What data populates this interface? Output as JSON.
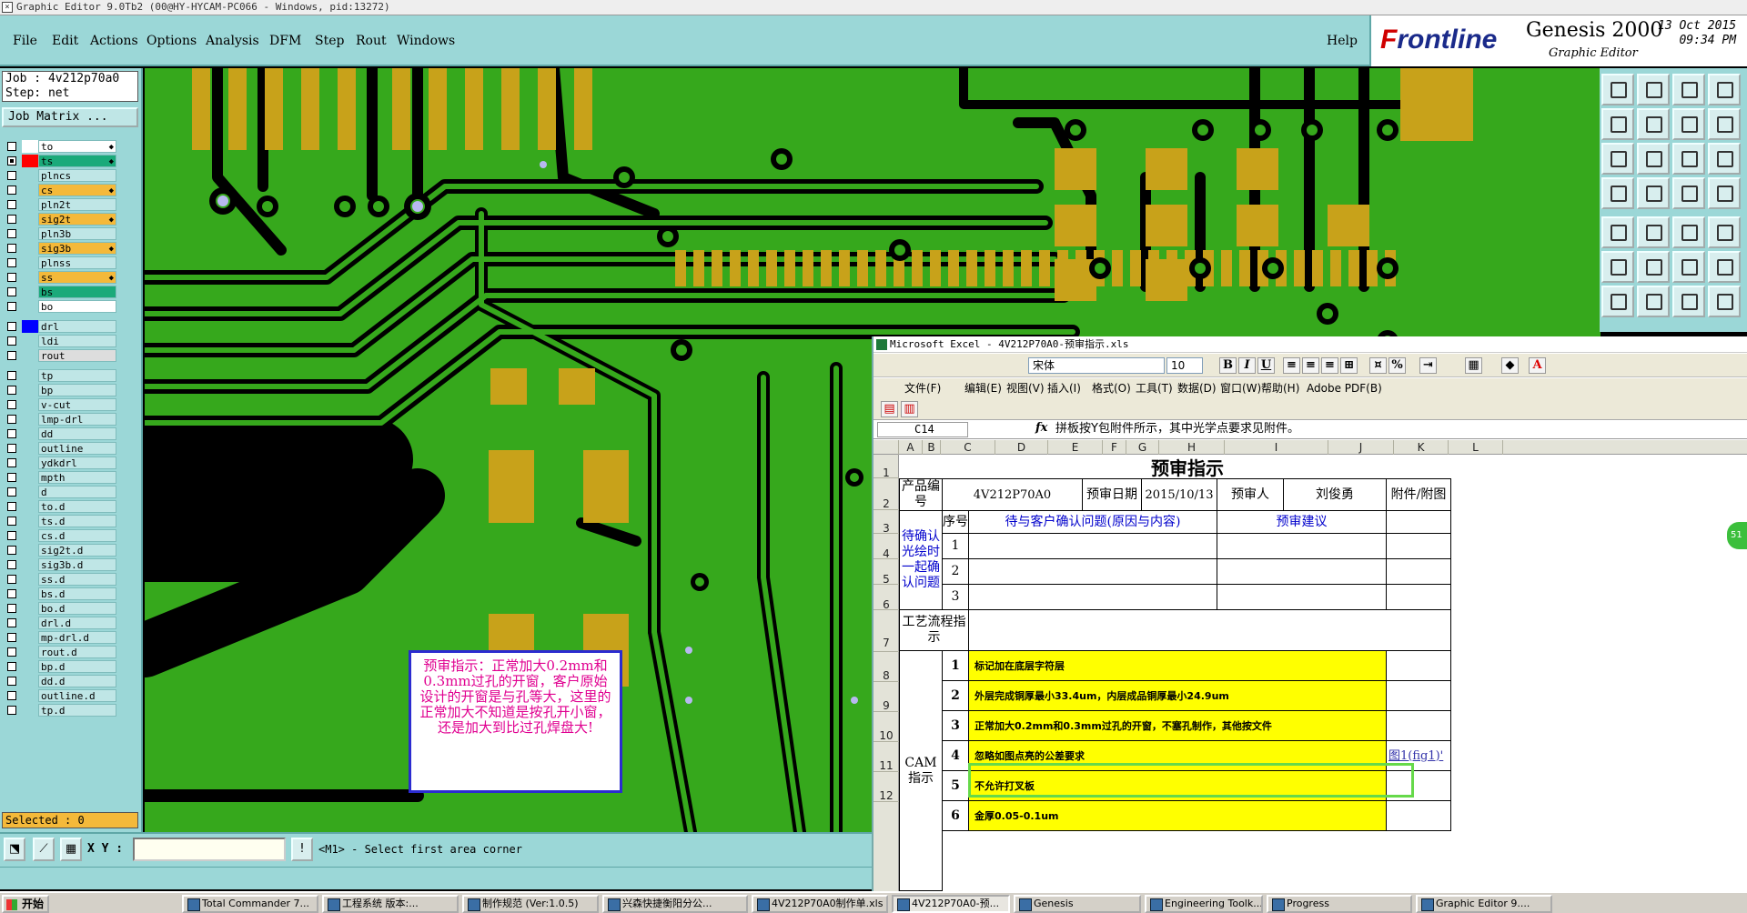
{
  "window": {
    "title": "Graphic Editor 9.0Tb2 (00@HY-HYCAM-PC066 - Windows, pid:13272)"
  },
  "menu": {
    "file": "File",
    "edit": "Edit",
    "actions": "Actions",
    "options": "Options",
    "analysis": "Analysis",
    "dfm": "DFM",
    "step": "Step",
    "rout": "Rout",
    "windows": "Windows",
    "help": "Help"
  },
  "brand": {
    "frontline_f": "F",
    "frontline_rest": "rontline",
    "genesis": "Genesis 2000",
    "graphic_editor": "Graphic Editor",
    "date": "13 Oct 2015",
    "time": "09:34 PM"
  },
  "job": {
    "job_line": "Job : 4v212p70a0",
    "step_line": "Step: net",
    "job_matrix": "Job Matrix ..."
  },
  "layers": [
    {
      "name": "to",
      "color": "#ffffff",
      "swatch": "#ffffff",
      "checked": false,
      "arrow": "◆"
    },
    {
      "name": "ts",
      "color": "#1aaa7a",
      "swatch": "#ff0000",
      "checked": true,
      "arrow": "◆"
    },
    {
      "name": "plncs",
      "color": "#bfe6e6",
      "swatch": "#9bd7d7",
      "checked": false,
      "arrow": ""
    },
    {
      "name": "cs",
      "color": "#f4b93a",
      "swatch": "#9bd7d7",
      "checked": false,
      "arrow": "◆"
    },
    {
      "name": "pln2t",
      "color": "#bfe6e6",
      "swatch": "#9bd7d7",
      "checked": false,
      "arrow": ""
    },
    {
      "name": "sig2t",
      "color": "#f4b93a",
      "swatch": "#9bd7d7",
      "checked": false,
      "arrow": "◆"
    },
    {
      "name": "pln3b",
      "color": "#bfe6e6",
      "swatch": "#9bd7d7",
      "checked": false,
      "arrow": ""
    },
    {
      "name": "sig3b",
      "color": "#f4b93a",
      "swatch": "#9bd7d7",
      "checked": false,
      "arrow": "◆"
    },
    {
      "name": "plnss",
      "color": "#bfe6e6",
      "swatch": "#9bd7d7",
      "checked": false,
      "arrow": ""
    },
    {
      "name": "ss",
      "color": "#f4b93a",
      "swatch": "#9bd7d7",
      "checked": false,
      "arrow": "◆"
    },
    {
      "name": "bs",
      "color": "#1aaa7a",
      "swatch": "#9bd7d7",
      "checked": false,
      "arrow": ""
    },
    {
      "name": "bo",
      "color": "#ffffff",
      "swatch": "#9bd7d7",
      "checked": false,
      "arrow": ""
    },
    {
      "name": "drl",
      "color": "#bfe6e6",
      "swatch": "#0000ff",
      "checked": false,
      "arrow": ""
    },
    {
      "name": "ldi",
      "color": "#bfe6e6",
      "swatch": "#9bd7d7",
      "checked": false,
      "arrow": ""
    },
    {
      "name": "rout",
      "color": "#dddddd",
      "swatch": "#9bd7d7",
      "checked": false,
      "arrow": ""
    },
    {
      "name": "tp",
      "color": "#bfe6e6",
      "swatch": "#9bd7d7",
      "checked": false,
      "arrow": ""
    },
    {
      "name": "bp",
      "color": "#bfe6e6",
      "swatch": "#9bd7d7",
      "checked": false,
      "arrow": ""
    },
    {
      "name": "v-cut",
      "color": "#bfe6e6",
      "swatch": "#9bd7d7",
      "checked": false,
      "arrow": ""
    },
    {
      "name": "lmp-drl",
      "color": "#bfe6e6",
      "swatch": "#9bd7d7",
      "checked": false,
      "arrow": ""
    },
    {
      "name": "dd",
      "color": "#bfe6e6",
      "swatch": "#9bd7d7",
      "checked": false,
      "arrow": ""
    },
    {
      "name": "outline",
      "color": "#bfe6e6",
      "swatch": "#9bd7d7",
      "checked": false,
      "arrow": ""
    },
    {
      "name": "ydkdrl",
      "color": "#bfe6e6",
      "swatch": "#9bd7d7",
      "checked": false,
      "arrow": ""
    },
    {
      "name": "mpth",
      "color": "#bfe6e6",
      "swatch": "#9bd7d7",
      "checked": false,
      "arrow": ""
    },
    {
      "name": "d",
      "color": "#bfe6e6",
      "swatch": "#9bd7d7",
      "checked": false,
      "arrow": ""
    },
    {
      "name": "to.d",
      "color": "#bfe6e6",
      "swatch": "#9bd7d7",
      "checked": false,
      "arrow": ""
    },
    {
      "name": "ts.d",
      "color": "#bfe6e6",
      "swatch": "#9bd7d7",
      "checked": false,
      "arrow": ""
    },
    {
      "name": "cs.d",
      "color": "#bfe6e6",
      "swatch": "#9bd7d7",
      "checked": false,
      "arrow": ""
    },
    {
      "name": "sig2t.d",
      "color": "#bfe6e6",
      "swatch": "#9bd7d7",
      "checked": false,
      "arrow": ""
    },
    {
      "name": "sig3b.d",
      "color": "#bfe6e6",
      "swatch": "#9bd7d7",
      "checked": false,
      "arrow": ""
    },
    {
      "name": "ss.d",
      "color": "#bfe6e6",
      "swatch": "#9bd7d7",
      "checked": false,
      "arrow": ""
    },
    {
      "name": "bs.d",
      "color": "#bfe6e6",
      "swatch": "#9bd7d7",
      "checked": false,
      "arrow": ""
    },
    {
      "name": "bo.d",
      "color": "#bfe6e6",
      "swatch": "#9bd7d7",
      "checked": false,
      "arrow": ""
    },
    {
      "name": "drl.d",
      "color": "#bfe6e6",
      "swatch": "#9bd7d7",
      "checked": false,
      "arrow": ""
    },
    {
      "name": "mp-drl.d",
      "color": "#bfe6e6",
      "swatch": "#9bd7d7",
      "checked": false,
      "arrow": ""
    },
    {
      "name": "rout.d",
      "color": "#bfe6e6",
      "swatch": "#9bd7d7",
      "checked": false,
      "arrow": ""
    },
    {
      "name": "bp.d",
      "color": "#bfe6e6",
      "swatch": "#9bd7d7",
      "checked": false,
      "arrow": ""
    },
    {
      "name": "dd.d",
      "color": "#bfe6e6",
      "swatch": "#9bd7d7",
      "checked": false,
      "arrow": ""
    },
    {
      "name": "outline.d",
      "color": "#bfe6e6",
      "swatch": "#9bd7d7",
      "checked": false,
      "arrow": ""
    },
    {
      "name": "tp.d",
      "color": "#bfe6e6",
      "swatch": "#9bd7d7",
      "checked": false,
      "arrow": ""
    }
  ],
  "selected": "Selected : 0",
  "popup_note": "预审指示：正常加大0.2mm和0.3mm过孔的开窗，客户原始设计的开窗是与孔等大，这里的正常加大不知道是按孔开小窗，还是加大到比过孔焊盘大!",
  "statusbar": {
    "xy_label": "X Y :",
    "xy_value": "",
    "prompt": "<M1> - Select first area corner"
  },
  "excel": {
    "title": "Microsoft Excel - 4V212P70A0-预审指示.xls",
    "font": "宋体",
    "size": "10",
    "menu": [
      "文件(F)",
      "编辑(E)",
      "视图(V)",
      "插入(I)",
      "格式(O)",
      "工具(T)",
      "数据(D)",
      "窗口(W)",
      "帮助(H)",
      "Adobe PDF(B)"
    ],
    "namebox": "C14",
    "formula": "拼板按Y包附件所示，其中光学点要求见附件。",
    "columns": [
      "A",
      "B",
      "C",
      "D",
      "E",
      "F",
      "G",
      "H",
      "I",
      "J",
      "K",
      "L"
    ],
    "rows": [
      "1",
      "2",
      "3",
      "4",
      "5",
      "6",
      "7",
      "8",
      "9",
      "10",
      "11",
      "12"
    ],
    "sheet_title": "预审指示",
    "product_label": "产品编号",
    "product_value": "4V212P70A0",
    "review_date_label": "预审日期",
    "review_date_value": "2015/10/13",
    "reviewer_label": "预审人",
    "reviewer_value": "刘俊勇",
    "attachment_label": "附件/附图",
    "seq_label": "序号",
    "issue_label": "待与客户确认问题(原因与内容)",
    "suggest_label": "预审建议",
    "confirm_group": "待确认光绘时一起确认问题",
    "confirm_nums": [
      "1",
      "2",
      "3"
    ],
    "process_label": "工艺流程指示",
    "cam_label": "CAM指示",
    "cam_items": [
      {
        "n": "1",
        "text": "标记加在底层字符层",
        "attach": ""
      },
      {
        "n": "2",
        "text": "外层完成铜厚最小33.4um，内层成品铜厚最小24.9um",
        "attach": ""
      },
      {
        "n": "3",
        "text": "正常加大0.2mm和0.3mm过孔的开窗，不塞孔制作，其他按文件",
        "attach": ""
      },
      {
        "n": "4",
        "text": "忽略如图点亮的公差要求",
        "attach": "图1(fig1)'"
      },
      {
        "n": "5",
        "text": "不允许打叉板",
        "attach": ""
      },
      {
        "n": "6",
        "text": "金厚0.05-0.1um",
        "attach": ""
      }
    ]
  },
  "taskbar": {
    "start": "开始",
    "tasks": [
      "Total Commander 7...",
      "工程系统  版本:...",
      "制作规范 (Ver:1.0.5)",
      "兴森快捷衡阳分公...",
      "4V212P70A0制作单.xls",
      "4V212P70A0-预...",
      "Genesis",
      "Engineering Toolk...",
      "Progress",
      "Graphic Editor 9...."
    ]
  },
  "side_badge": "51"
}
